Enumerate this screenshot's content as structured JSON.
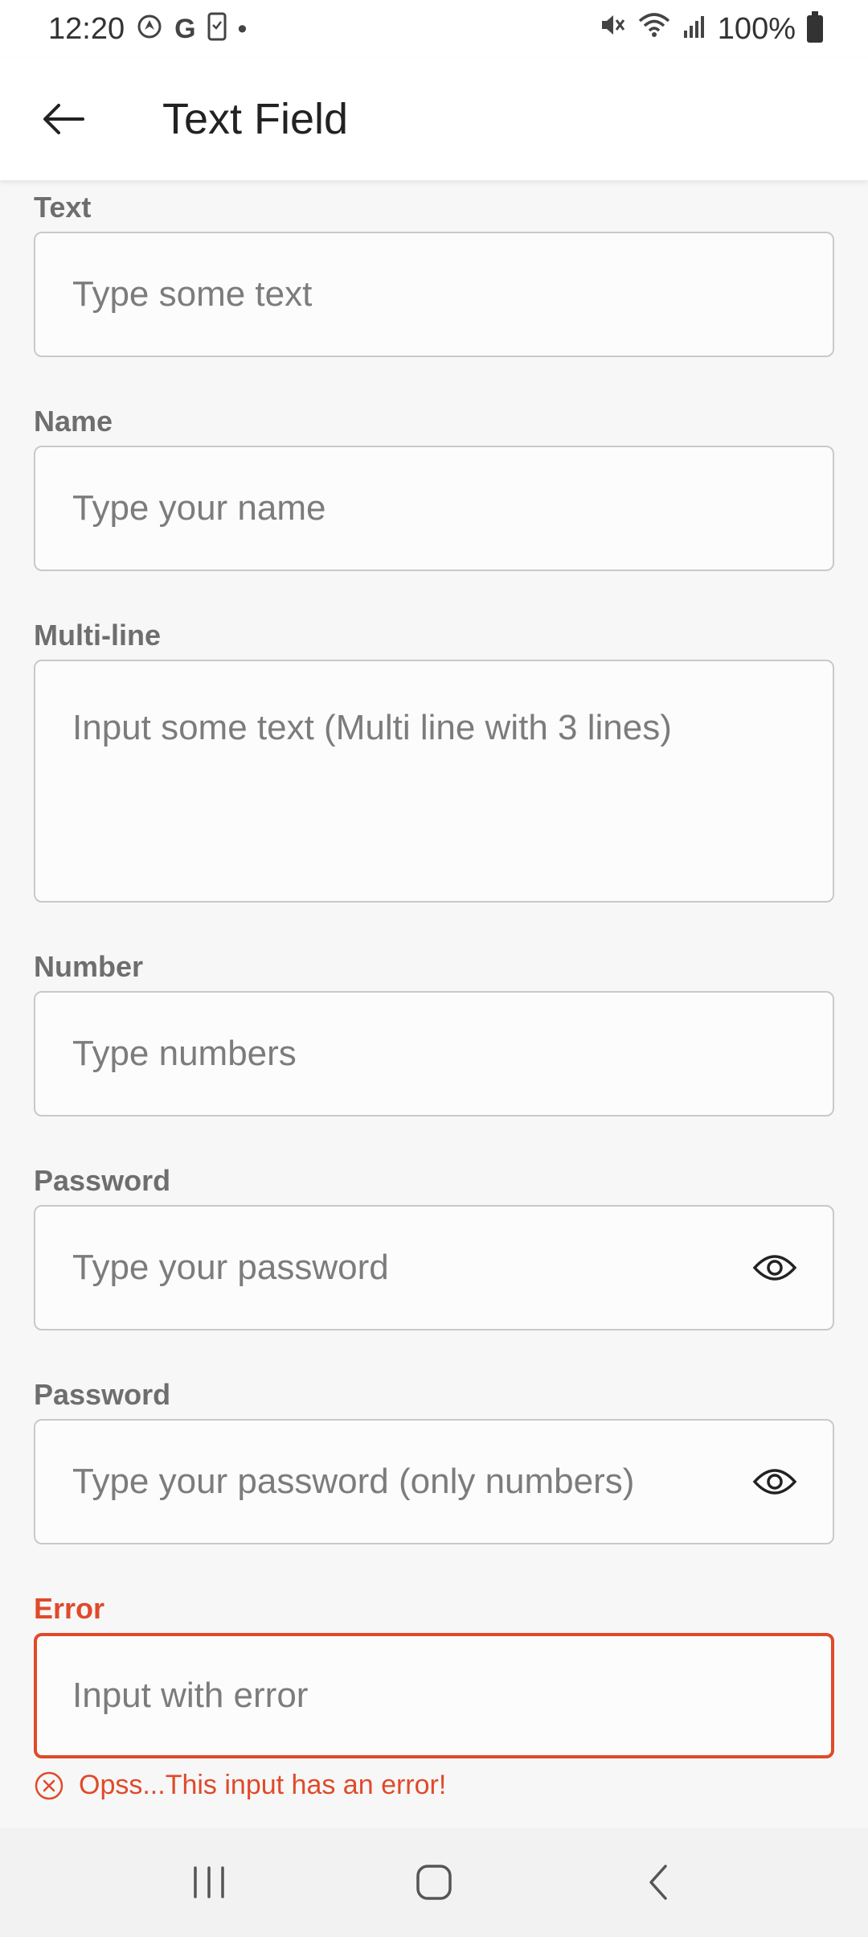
{
  "status_bar": {
    "time": "12:20",
    "notification_icons": [
      "location-icon",
      "google-icon",
      "phone-icon",
      "dot-icon"
    ],
    "battery": "100%",
    "icons": [
      "mute-icon",
      "wifi-icon",
      "signal-icon",
      "battery-icon"
    ]
  },
  "app_bar": {
    "title": "Text Field",
    "back_icon": "arrow-left-icon"
  },
  "fields": {
    "text": {
      "label": "Text",
      "placeholder": "Type some text",
      "value": ""
    },
    "name": {
      "label": "Name",
      "placeholder": "Type your name",
      "value": ""
    },
    "multiline": {
      "label": "Multi-line",
      "placeholder": "Input some text (Multi line with 3 lines)",
      "value": ""
    },
    "number": {
      "label": "Number",
      "placeholder": "Type numbers",
      "value": ""
    },
    "password": {
      "label": "Password",
      "placeholder": "Type your password",
      "value": "",
      "toggle_icon": "eye-icon"
    },
    "password_numeric": {
      "label": "Password",
      "placeholder": "Type your password (only numbers)",
      "value": "",
      "toggle_icon": "eye-icon"
    },
    "error": {
      "label": "Error",
      "placeholder": "Input with error",
      "value": "",
      "error_message": "Opss...This input has an error!"
    }
  },
  "colors": {
    "error": "#e04a2a",
    "border": "#c9c9c9",
    "label": "#6e6e6e",
    "background": "#f7f7f7"
  },
  "nav_bar": {
    "buttons": [
      "recent-apps-icon",
      "home-icon",
      "back-icon"
    ]
  }
}
